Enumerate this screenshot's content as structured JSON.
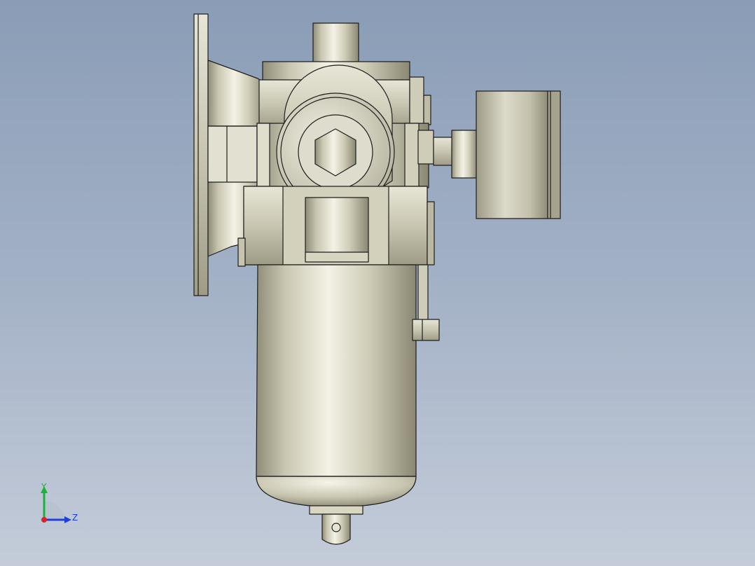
{
  "viewport": {
    "colors": {
      "background_top": "#8a9db6",
      "background_bottom": "#c4ccd9",
      "metal_light": "#f3f1e4",
      "metal_mid": "#c8c5b0",
      "metal_dark": "#8f8c78",
      "edge": "#1e1e1e"
    }
  },
  "triad": {
    "y_label": "Y",
    "z_label": "Z",
    "colors": {
      "y": "#19b33b",
      "z": "#1f3fd6",
      "x": "#d6262b"
    }
  }
}
